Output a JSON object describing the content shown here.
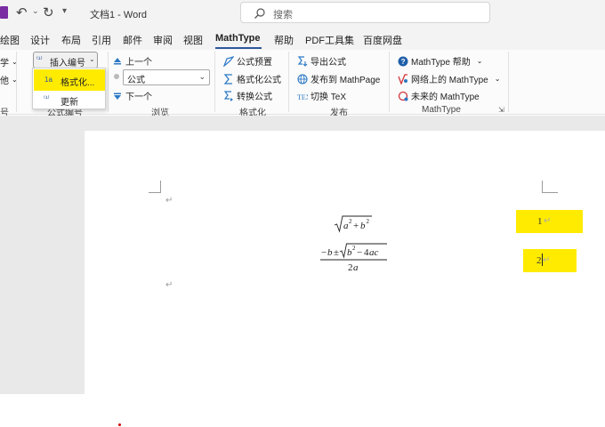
{
  "titlebar": {
    "doc_title": "文档1 - Word",
    "search_placeholder": "搜索"
  },
  "tabs": [
    {
      "label": "绘图"
    },
    {
      "label": "设计"
    },
    {
      "label": "布局"
    },
    {
      "label": "引用"
    },
    {
      "label": "邮件"
    },
    {
      "label": "审阅"
    },
    {
      "label": "视图"
    },
    {
      "label": "MathType"
    },
    {
      "label": "帮助"
    },
    {
      "label": "PDF工具集"
    },
    {
      "label": "百度网盘"
    }
  ],
  "active_tab": "MathType",
  "ribbon": {
    "partial_left": {
      "line1": "学",
      "line2": "他",
      "group": "号"
    },
    "equation_numbers": {
      "insert_label": "插入编号",
      "group_label": "公式编号",
      "menu": {
        "format": "格式化...",
        "update": "更新"
      }
    },
    "browse": {
      "prev": "上一个",
      "select_value": "公式",
      "next": "下一个",
      "group_label": "浏览"
    },
    "format": {
      "preset": "公式预置",
      "format_eq": "格式化公式",
      "convert": "转换公式",
      "group_label": "格式化"
    },
    "publish": {
      "export": "导出公式",
      "mathpage": "发布到 MathPage",
      "tex": "切换 TeX",
      "group_label": "发布"
    },
    "mathtype": {
      "help": "MathType 帮助",
      "online": "网络上的 MathType",
      "future": "未来的 MathType",
      "group_label": "MathType"
    }
  },
  "document": {
    "eq_numbers": [
      "1",
      "2"
    ],
    "colors": {
      "highlight": "#ffeb00",
      "accent": "#2b579a"
    }
  }
}
